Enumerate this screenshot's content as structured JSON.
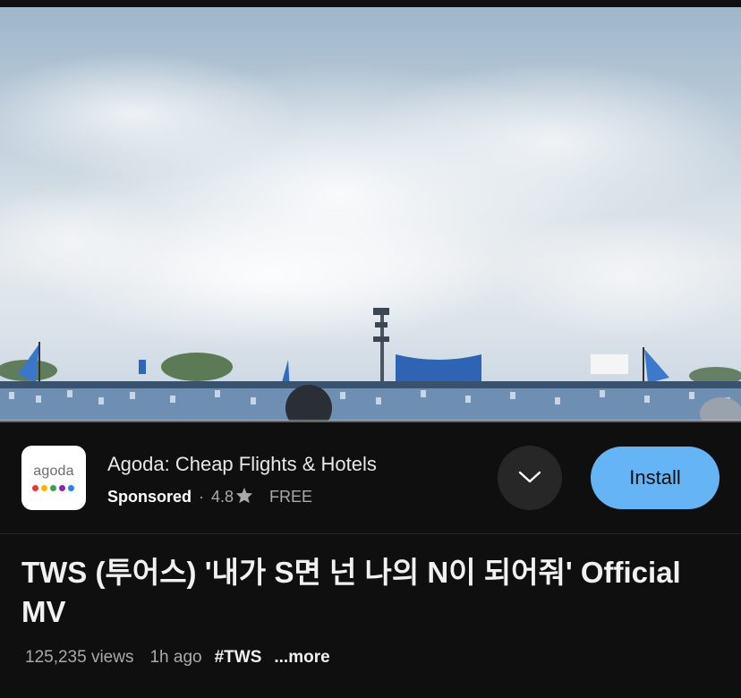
{
  "player": {
    "scene": "Blue sky with clouds over a stadium crowd waving blue flags",
    "progress_fraction": 0.0
  },
  "ad": {
    "logo_text": "agoda",
    "logo_dot_colors": [
      "#e53935",
      "#ffb300",
      "#43a047",
      "#8e24aa",
      "#1e88e5"
    ],
    "title": "Agoda: Cheap Flights & Hotels",
    "sponsored_label": "Sponsored",
    "separator": "·",
    "rating": "4.8",
    "rating_icon": "star-icon",
    "price": "FREE",
    "expand_icon": "chevron-down-icon",
    "install_label": "Install",
    "install_color": "#65b5f6"
  },
  "video": {
    "title": "TWS (투어스) '내가 S면 넌 나의 N이 되어줘' Official MV",
    "views": "125,235 views",
    "time_ago": "1h ago",
    "hashtag": "#TWS",
    "more_label": "...more"
  }
}
